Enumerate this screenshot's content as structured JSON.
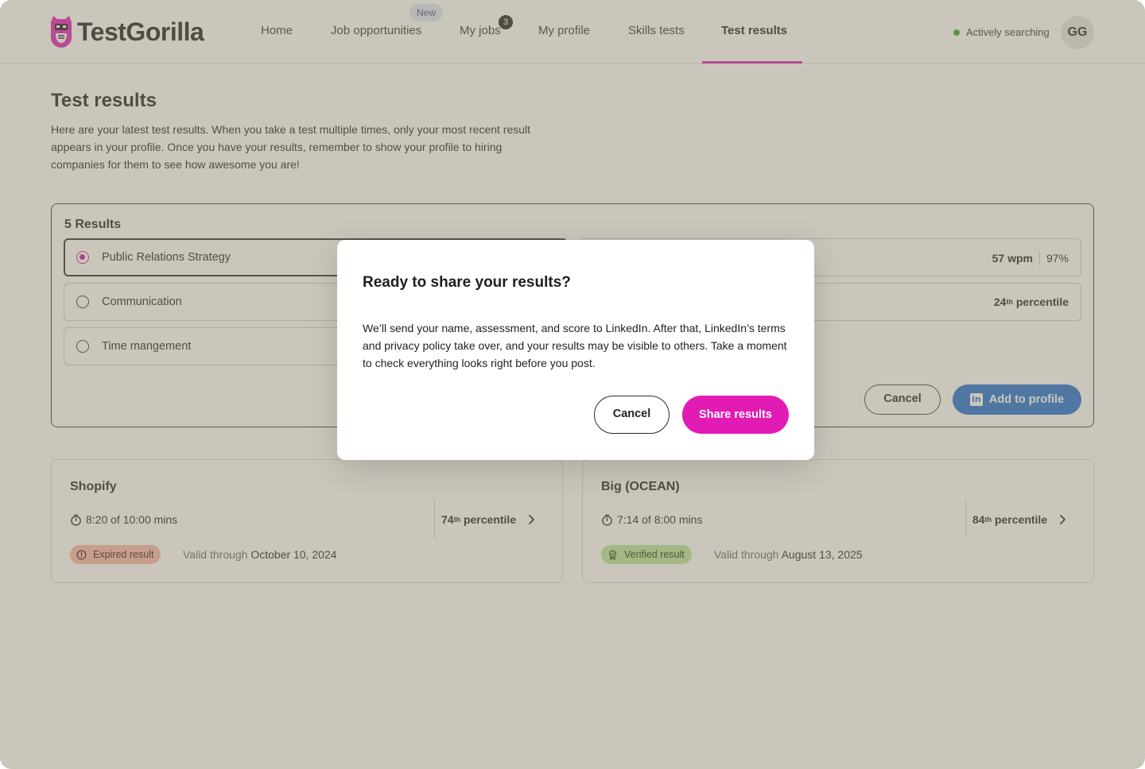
{
  "header": {
    "logo_text": "TestGorilla",
    "nav": [
      {
        "label": "Home"
      },
      {
        "label": "Job opportunities",
        "badge": "New"
      },
      {
        "label": "My jobs",
        "count": "3"
      },
      {
        "label": "My profile"
      },
      {
        "label": "Skills tests"
      },
      {
        "label": "Test results",
        "active": true
      }
    ],
    "status": "Actively searching",
    "avatar_initials": "GG",
    "accent_color": "#e21bb5"
  },
  "page": {
    "title": "Test results",
    "description": "Here are your latest test results. When you take a test multiple times, only your most recent result appears in your profile. Once you have your results, remember to show your profile to hiring companies for them to see how awesome you are!"
  },
  "results": {
    "count_label": "5 Results",
    "options": [
      {
        "label": "Public Relations Strategy",
        "selected": true
      },
      {
        "label": "Communication",
        "selected": false
      },
      {
        "label": "Time mangement",
        "selected": false
      }
    ],
    "right_scores": [
      {
        "wpm": "57 wpm",
        "pct": "97%"
      },
      {
        "percentile_num": "24",
        "percentile_sup": "th",
        "percentile_word": "percentile"
      }
    ],
    "cancel_label": "Cancel",
    "add_label": "Add to profile"
  },
  "cards": [
    {
      "title": "Shopify",
      "time": "8:20 of 10:00 mins",
      "percentile_num": "74",
      "percentile_sup": "th",
      "percentile_word": "percentile",
      "badge": "Expired result",
      "valid_prefix": "Valid through",
      "valid_date": "October 10, 2024"
    },
    {
      "title": "Big (OCEAN)",
      "time": "7:14 of 8:00 mins",
      "percentile_num": "84",
      "percentile_sup": "th",
      "percentile_word": "percentile",
      "badge": "Verified result",
      "valid_prefix": "Valid through",
      "valid_date": "August 13, 2025"
    }
  ],
  "modal": {
    "title": "Ready to share your results?",
    "body": "We’ll send your name, assessment, and score to LinkedIn. After that, LinkedIn’s terms and privacy policy take over, and your results may be visible to others. Take a moment to check everything looks right before you post.",
    "cancel_label": "Cancel",
    "share_label": "Share results"
  }
}
